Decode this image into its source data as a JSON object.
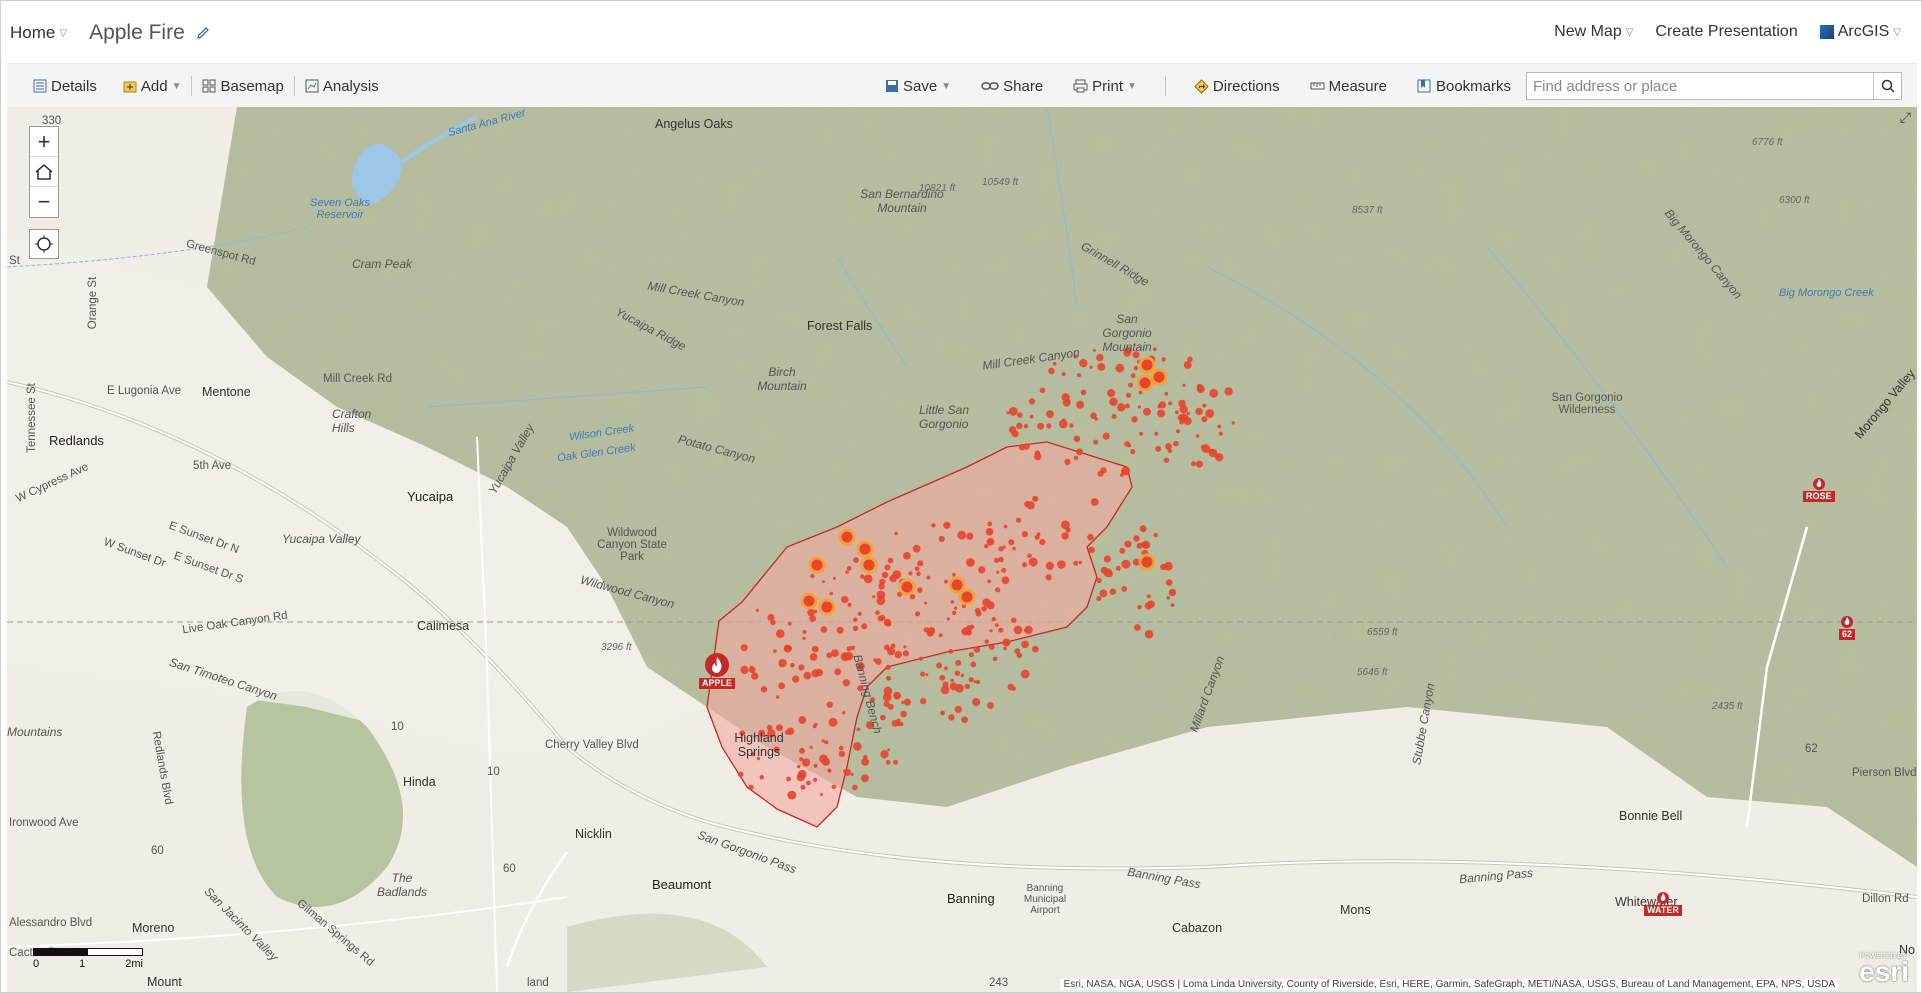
{
  "header": {
    "home_label": "Home",
    "map_title": "Apple Fire",
    "new_map_label": "New Map",
    "create_presentation_label": "Create Presentation",
    "arcgis_label": "ArcGIS"
  },
  "toolbar": {
    "details_label": "Details",
    "add_label": "Add",
    "basemap_label": "Basemap",
    "analysis_label": "Analysis",
    "save_label": "Save",
    "share_label": "Share",
    "print_label": "Print",
    "directions_label": "Directions",
    "measure_label": "Measure",
    "bookmarks_label": "Bookmarks",
    "search_placeholder": "Find address or place"
  },
  "map": {
    "zoom_in": "+",
    "zoom_out": "−",
    "places": {
      "angelus_oaks": "Angelus Oaks",
      "seven_oaks": "Seven Oaks Reservoir",
      "cram_peak": "Cram Peak",
      "greenspot": "Greenspot Rd",
      "san_bernardino_mtn": "San Bernardino Mountain",
      "elev_10821": "10821 ft",
      "elev_10549": "10549 ft",
      "grinnell": "Grinnell Ridge",
      "elev_8537": "8537 ft",
      "elev_6776": "6776 ft",
      "elev_6300": "6300 ft",
      "big_morongo_canyon": "Big Morongo Canyon",
      "big_morongo_creek": "Big Morongo Creek",
      "san_gorgonio_mtn": "San Gorgonio Mountain",
      "forest_falls": "Forest Falls",
      "mill_creek_canyon": "Mill Creek Canyon",
      "mill_creek_canyon2": "Mill Creek Canyon",
      "yucaipa_ridge": "Yucaipa Ridge",
      "birch_mtn": "Birch Mountain",
      "little_san": "Little San Gorgonio",
      "san_gorgonio_wild": "San Gorgonio Wilderness",
      "morongo_valley": "Morongo Valley",
      "e_lugonia": "E Lugonia Ave",
      "mentone": "Mentone",
      "mill_creek_rd": "Mill Creek Rd",
      "orange_st": "Orange St",
      "tennessee": "Tennessee St",
      "redlands": "Redlands",
      "crafton": "Crafton Hills",
      "fifth_ave": "5th Ave",
      "wilson_creek": "Wilson Creek",
      "oak_glen": "Oak Glen Creek",
      "potato": "Potato Canyon",
      "w_cypress": "W Cypress Ave",
      "e_sunset": "E Sunset Dr N",
      "w_sunset": "W Sunset Dr",
      "e_sunset_s": "E Sunset Dr S",
      "yucaipa_valley_v": "Yucaipa Valley",
      "yucaipa_valley": "Yucaipa Valley",
      "yucaipa": "Yucaipa",
      "wildwood_park": "Wildwood Canyon State Park",
      "wildwood_canyon": "Wildwood Canyon",
      "calimesa": "Calimesa",
      "live_oak": "Live Oak Canyon Rd",
      "elev_3296": "3296 ft",
      "san_timoteo": "San Timoteo Canyon",
      "cherry_valley": "Cherry Valley Blvd",
      "highland_springs": "Highland Springs",
      "banning_bench": "Banning Bench",
      "hinda": "Hinda",
      "nicklin": "Nicklin",
      "the_badlands": "The Badlands",
      "beaumont": "Beaumont",
      "sgp": "San Gorgonio Pass",
      "banning": "Banning",
      "banning_airport": "Banning Municipal Airport",
      "banning_pass": "Banning Pass",
      "banning_pass2": "Banning Pass",
      "cabazon": "Cabazon",
      "moreno": "Moreno",
      "alessandro": "Alessandro Blvd",
      "san_jacinto_valley": "San Jacinto Valley",
      "gilman": "Gilman Springs Rd",
      "millard": "Millard Canyon",
      "stubbe": "Stubbe Canyon",
      "elev_6559": "6559 ft",
      "elev_5646": "5646 ft",
      "elev_2435": "2435 ft",
      "pierson": "Pierson Blvd",
      "bonnie_bell": "Bonnie Bell",
      "whitewater": "Whitewater",
      "dillon": "Dillon Rd",
      "mons": "Mons",
      "redlands_blvd": "Redlands Blvd",
      "wood_ave": "Ironwood Ave",
      "mountains": "Mountains",
      "mount": "Mount",
      "santa_ana": "Santa Ana River",
      "cactus": "Cactus Dr",
      "route_330": "330",
      "route_10a": "10",
      "route_10b": "10",
      "route_60a": "60",
      "route_60b": "60",
      "route_243": "243",
      "route_62": "62",
      "land": "land",
      "st": "St",
      "no": "No"
    },
    "fires": {
      "apple": "APPLE",
      "rose": "ROSE",
      "other": "62",
      "water": "WATER"
    },
    "scale": {
      "t0": "0",
      "t1": "1",
      "t2": "2mi"
    },
    "attribution": "Esri, NASA, NGA, USGS | Loma Linda University, County of Riverside, Esri, HERE, Garmin, SafeGraph, METI/NASA, USGS, Bureau of Land Management, EPA, NPS, USDA",
    "esri": "esri",
    "powered": "POWERED BY"
  },
  "colors": {
    "fire_dot": "#e8432b",
    "hotspot": "#f2a23a",
    "perimeter_fill": "#f4a9a0",
    "perimeter_stroke": "#c62828",
    "terrain": "#a9b393",
    "ground": "#efede6"
  }
}
